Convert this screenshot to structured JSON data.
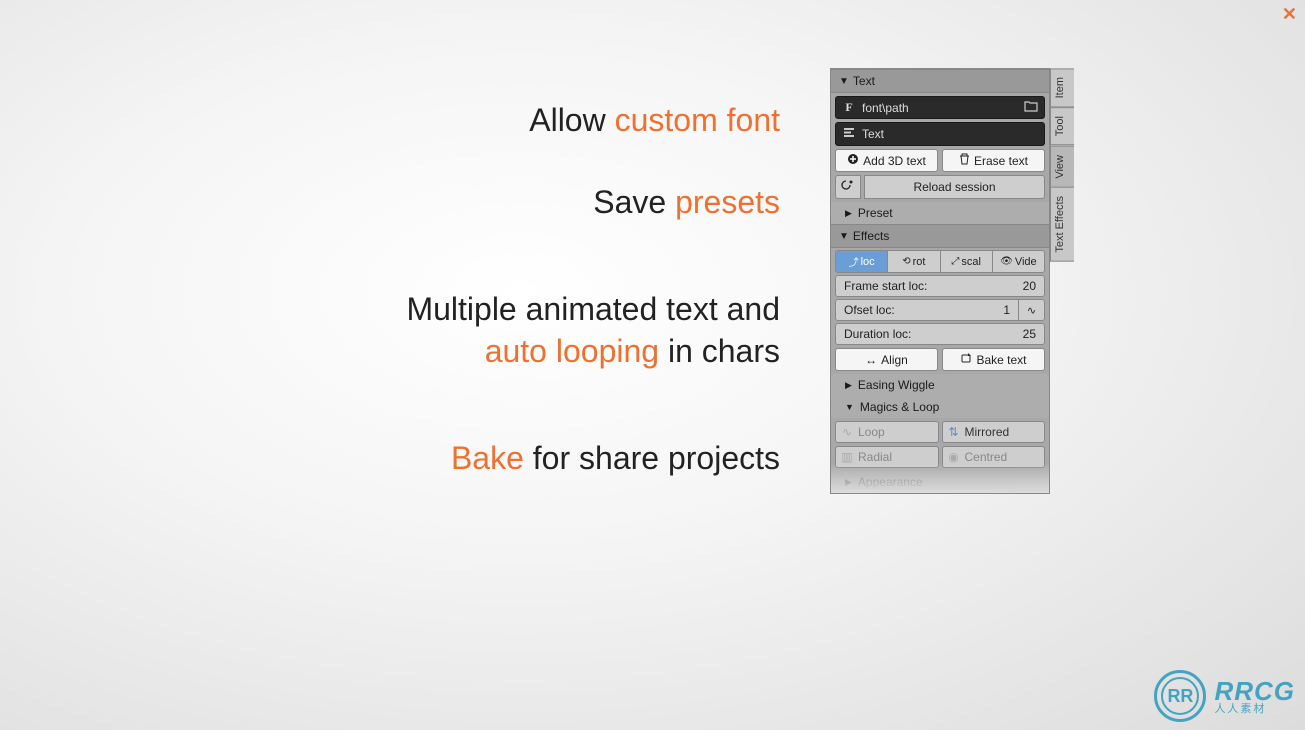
{
  "close_x": "✕",
  "features": {
    "line1_a": "Allow ",
    "line1_b": "custom font",
    "line2_a": "Save ",
    "line2_b": "presets",
    "line3_a": "Multiple animated text and",
    "line3_b": "auto looping",
    "line3_c": " in chars",
    "line4_a": "Bake",
    "line4_b": " for share projects"
  },
  "vtabs": {
    "item": "Item",
    "tool": "Tool",
    "view": "View",
    "texteffects": "Text Effects"
  },
  "panel": {
    "text_header": "Text",
    "font_path": "font\\path",
    "text_field": "Text",
    "add_3d_text": "Add 3D text",
    "erase_text": "Erase text",
    "reload_session": "Reload session",
    "preset": "Preset",
    "effects_header": "Effects",
    "tabs": {
      "loc": "loc",
      "rot": "rot",
      "scal": "scal",
      "vide": "Vide"
    },
    "frame_start_loc": {
      "label": "Frame start loc:",
      "value": "20"
    },
    "offset_loc": {
      "label": "Ofset loc:",
      "value": "1"
    },
    "duration_loc": {
      "label": "Duration loc:",
      "value": "25"
    },
    "align": "Align",
    "bake_text": "Bake text",
    "easing_wiggle": "Easing Wiggle",
    "magics_loop": "Magics & Loop",
    "loop": "Loop",
    "mirrored": "Mirrored",
    "radial": "Radial",
    "centred": "Centred",
    "appearance": "Appearance"
  },
  "watermark": {
    "badge": "RR",
    "big": "RRCG",
    "small": "人人素材"
  }
}
